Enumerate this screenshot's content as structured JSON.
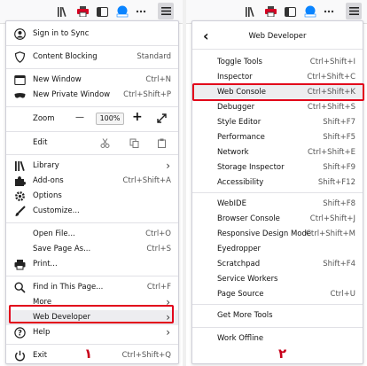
{
  "menu1": {
    "sign_in": "Sign in to Sync",
    "content_blocking": "Content Blocking",
    "content_blocking_value": "Standard",
    "new_window": "New Window",
    "new_window_sc": "Ctrl+N",
    "new_private": "New Private Window",
    "new_private_sc": "Ctrl+Shift+P",
    "zoom": "Zoom",
    "zoom_minus": "—",
    "zoom_value": "100%",
    "zoom_plus": "+",
    "edit": "Edit",
    "library": "Library",
    "addons": "Add-ons",
    "addons_sc": "Ctrl+Shift+A",
    "options": "Options",
    "customize": "Customize...",
    "open_file": "Open File...",
    "open_file_sc": "Ctrl+O",
    "save_page": "Save Page As...",
    "save_page_sc": "Ctrl+S",
    "print": "Print...",
    "find": "Find in This Page...",
    "find_sc": "Ctrl+F",
    "more": "More",
    "web_developer": "Web Developer",
    "help": "Help",
    "exit": "Exit",
    "exit_sc": "Ctrl+Shift+Q"
  },
  "menu2": {
    "back": "‹",
    "title": "Web Developer",
    "items": [
      {
        "label": "Toggle Tools",
        "sc": "Ctrl+Shift+I"
      },
      {
        "label": "Inspector",
        "sc": "Ctrl+Shift+C"
      },
      {
        "label": "Web Console",
        "sc": "Ctrl+Shift+K"
      },
      {
        "label": "Debugger",
        "sc": "Ctrl+Shift+S"
      },
      {
        "label": "Style Editor",
        "sc": "Shift+F7"
      },
      {
        "label": "Performance",
        "sc": "Shift+F5"
      },
      {
        "label": "Network",
        "sc": "Ctrl+Shift+E"
      },
      {
        "label": "Storage Inspector",
        "sc": "Shift+F9"
      },
      {
        "label": "Accessibility",
        "sc": "Shift+F12"
      },
      {
        "label": "WebIDE",
        "sc": "Shift+F8"
      },
      {
        "label": "Browser Console",
        "sc": "Ctrl+Shift+J"
      },
      {
        "label": "Responsive Design Mode",
        "sc": "Ctrl+Shift+M"
      },
      {
        "label": "Eyedropper",
        "sc": ""
      },
      {
        "label": "Scratchpad",
        "sc": "Shift+F4"
      },
      {
        "label": "Service Workers",
        "sc": ""
      },
      {
        "label": "Page Source",
        "sc": "Ctrl+U"
      },
      {
        "label": "Get More Tools",
        "sc": ""
      },
      {
        "label": "Work Offline",
        "sc": ""
      }
    ]
  },
  "annotations": {
    "one": "١",
    "two": "٢"
  },
  "colors": {
    "highlight": "#e2001a",
    "accent": "#0a84ff"
  }
}
